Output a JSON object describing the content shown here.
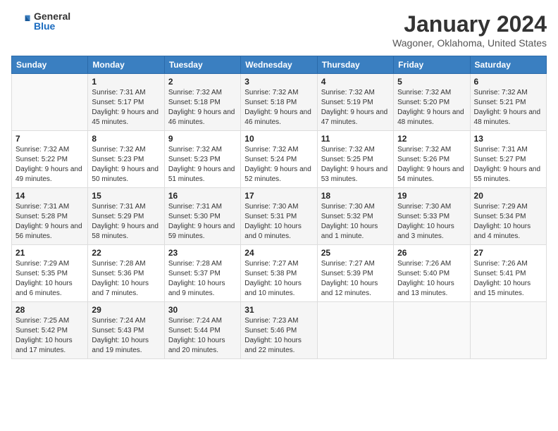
{
  "logo": {
    "general": "General",
    "blue": "Blue"
  },
  "header": {
    "month": "January 2024",
    "location": "Wagoner, Oklahoma, United States"
  },
  "weekdays": [
    "Sunday",
    "Monday",
    "Tuesday",
    "Wednesday",
    "Thursday",
    "Friday",
    "Saturday"
  ],
  "weeks": [
    [
      {
        "day": "",
        "sunrise": "",
        "sunset": "",
        "daylight": ""
      },
      {
        "day": "1",
        "sunrise": "7:31 AM",
        "sunset": "5:17 PM",
        "daylight": "9 hours and 45 minutes."
      },
      {
        "day": "2",
        "sunrise": "7:32 AM",
        "sunset": "5:18 PM",
        "daylight": "9 hours and 46 minutes."
      },
      {
        "day": "3",
        "sunrise": "7:32 AM",
        "sunset": "5:18 PM",
        "daylight": "9 hours and 46 minutes."
      },
      {
        "day": "4",
        "sunrise": "7:32 AM",
        "sunset": "5:19 PM",
        "daylight": "9 hours and 47 minutes."
      },
      {
        "day": "5",
        "sunrise": "7:32 AM",
        "sunset": "5:20 PM",
        "daylight": "9 hours and 48 minutes."
      },
      {
        "day": "6",
        "sunrise": "7:32 AM",
        "sunset": "5:21 PM",
        "daylight": "9 hours and 48 minutes."
      }
    ],
    [
      {
        "day": "7",
        "sunrise": "7:32 AM",
        "sunset": "5:22 PM",
        "daylight": "9 hours and 49 minutes."
      },
      {
        "day": "8",
        "sunrise": "7:32 AM",
        "sunset": "5:23 PM",
        "daylight": "9 hours and 50 minutes."
      },
      {
        "day": "9",
        "sunrise": "7:32 AM",
        "sunset": "5:23 PM",
        "daylight": "9 hours and 51 minutes."
      },
      {
        "day": "10",
        "sunrise": "7:32 AM",
        "sunset": "5:24 PM",
        "daylight": "9 hours and 52 minutes."
      },
      {
        "day": "11",
        "sunrise": "7:32 AM",
        "sunset": "5:25 PM",
        "daylight": "9 hours and 53 minutes."
      },
      {
        "day": "12",
        "sunrise": "7:32 AM",
        "sunset": "5:26 PM",
        "daylight": "9 hours and 54 minutes."
      },
      {
        "day": "13",
        "sunrise": "7:31 AM",
        "sunset": "5:27 PM",
        "daylight": "9 hours and 55 minutes."
      }
    ],
    [
      {
        "day": "14",
        "sunrise": "7:31 AM",
        "sunset": "5:28 PM",
        "daylight": "9 hours and 56 minutes."
      },
      {
        "day": "15",
        "sunrise": "7:31 AM",
        "sunset": "5:29 PM",
        "daylight": "9 hours and 58 minutes."
      },
      {
        "day": "16",
        "sunrise": "7:31 AM",
        "sunset": "5:30 PM",
        "daylight": "9 hours and 59 minutes."
      },
      {
        "day": "17",
        "sunrise": "7:30 AM",
        "sunset": "5:31 PM",
        "daylight": "10 hours and 0 minutes."
      },
      {
        "day": "18",
        "sunrise": "7:30 AM",
        "sunset": "5:32 PM",
        "daylight": "10 hours and 1 minute."
      },
      {
        "day": "19",
        "sunrise": "7:30 AM",
        "sunset": "5:33 PM",
        "daylight": "10 hours and 3 minutes."
      },
      {
        "day": "20",
        "sunrise": "7:29 AM",
        "sunset": "5:34 PM",
        "daylight": "10 hours and 4 minutes."
      }
    ],
    [
      {
        "day": "21",
        "sunrise": "7:29 AM",
        "sunset": "5:35 PM",
        "daylight": "10 hours and 6 minutes."
      },
      {
        "day": "22",
        "sunrise": "7:28 AM",
        "sunset": "5:36 PM",
        "daylight": "10 hours and 7 minutes."
      },
      {
        "day": "23",
        "sunrise": "7:28 AM",
        "sunset": "5:37 PM",
        "daylight": "10 hours and 9 minutes."
      },
      {
        "day": "24",
        "sunrise": "7:27 AM",
        "sunset": "5:38 PM",
        "daylight": "10 hours and 10 minutes."
      },
      {
        "day": "25",
        "sunrise": "7:27 AM",
        "sunset": "5:39 PM",
        "daylight": "10 hours and 12 minutes."
      },
      {
        "day": "26",
        "sunrise": "7:26 AM",
        "sunset": "5:40 PM",
        "daylight": "10 hours and 13 minutes."
      },
      {
        "day": "27",
        "sunrise": "7:26 AM",
        "sunset": "5:41 PM",
        "daylight": "10 hours and 15 minutes."
      }
    ],
    [
      {
        "day": "28",
        "sunrise": "7:25 AM",
        "sunset": "5:42 PM",
        "daylight": "10 hours and 17 minutes."
      },
      {
        "day": "29",
        "sunrise": "7:24 AM",
        "sunset": "5:43 PM",
        "daylight": "10 hours and 19 minutes."
      },
      {
        "day": "30",
        "sunrise": "7:24 AM",
        "sunset": "5:44 PM",
        "daylight": "10 hours and 20 minutes."
      },
      {
        "day": "31",
        "sunrise": "7:23 AM",
        "sunset": "5:46 PM",
        "daylight": "10 hours and 22 minutes."
      },
      {
        "day": "",
        "sunrise": "",
        "sunset": "",
        "daylight": ""
      },
      {
        "day": "",
        "sunrise": "",
        "sunset": "",
        "daylight": ""
      },
      {
        "day": "",
        "sunrise": "",
        "sunset": "",
        "daylight": ""
      }
    ]
  ],
  "labels": {
    "sunrise": "Sunrise:",
    "sunset": "Sunset:",
    "daylight": "Daylight:"
  }
}
